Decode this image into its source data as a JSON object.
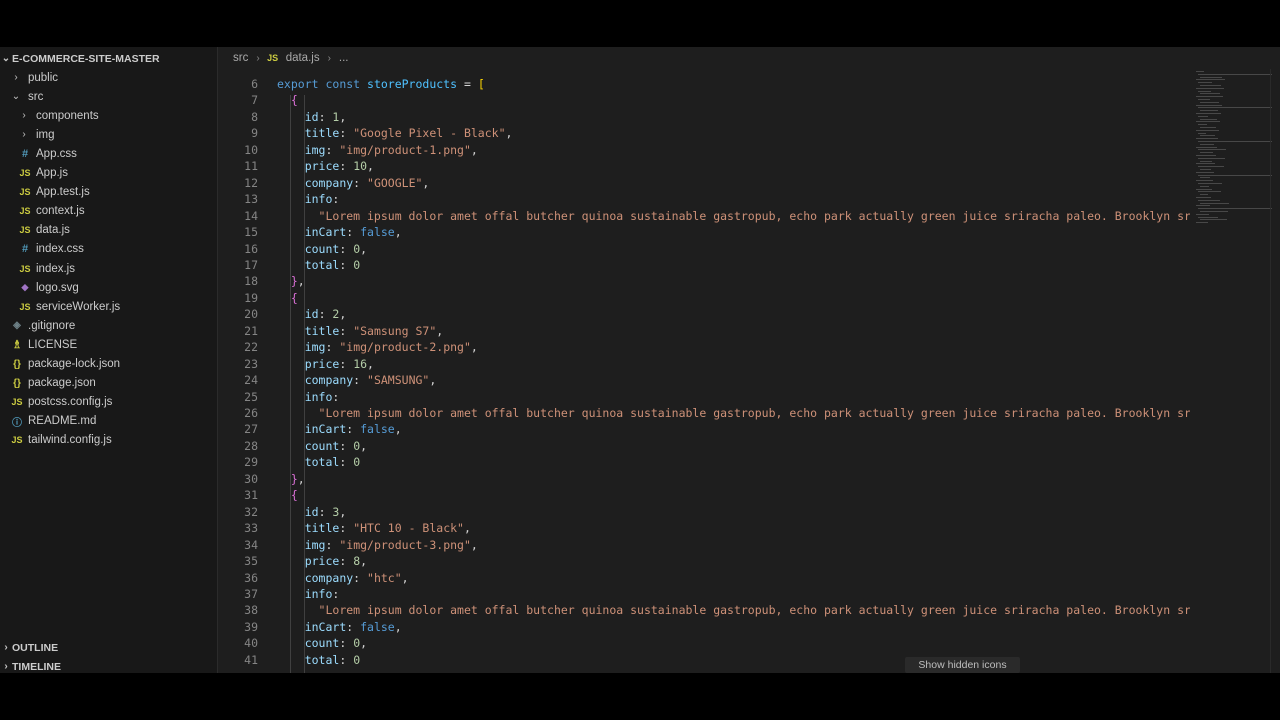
{
  "explorer": {
    "root": "E-COMMERCE-SITE-MASTER",
    "items": [
      {
        "label": "public",
        "kind": "folder",
        "chev": "›",
        "indent": 1
      },
      {
        "label": "src",
        "kind": "folder-open",
        "chev": "⌄",
        "indent": 1
      },
      {
        "label": "components",
        "kind": "folder",
        "chev": "›",
        "indent": 2
      },
      {
        "label": "img",
        "kind": "folder",
        "chev": "›",
        "indent": 2
      },
      {
        "label": "App.css",
        "kind": "css",
        "icon": "#",
        "indent": 2
      },
      {
        "label": "App.js",
        "kind": "js",
        "icon": "JS",
        "indent": 2
      },
      {
        "label": "App.test.js",
        "kind": "js",
        "icon": "JS",
        "indent": 2
      },
      {
        "label": "context.js",
        "kind": "js",
        "icon": "JS",
        "indent": 2
      },
      {
        "label": "data.js",
        "kind": "js",
        "icon": "JS",
        "indent": 2
      },
      {
        "label": "index.css",
        "kind": "css",
        "icon": "#",
        "indent": 2
      },
      {
        "label": "index.js",
        "kind": "js",
        "icon": "JS",
        "indent": 2
      },
      {
        "label": "logo.svg",
        "kind": "svg",
        "icon": "◆",
        "indent": 2
      },
      {
        "label": "serviceWorker.js",
        "kind": "js",
        "icon": "JS",
        "indent": 2
      },
      {
        "label": ".gitignore",
        "kind": "git",
        "icon": "◈",
        "indent": 1
      },
      {
        "label": "LICENSE",
        "kind": "lic",
        "icon": "♗",
        "indent": 1
      },
      {
        "label": "package-lock.json",
        "kind": "json",
        "icon": "{}",
        "indent": 1
      },
      {
        "label": "package.json",
        "kind": "json",
        "icon": "{}",
        "indent": 1
      },
      {
        "label": "postcss.config.js",
        "kind": "js",
        "icon": "JS",
        "indent": 1
      },
      {
        "label": "README.md",
        "kind": "md",
        "icon": "ⓘ",
        "indent": 1
      },
      {
        "label": "tailwind.config.js",
        "kind": "js",
        "icon": "JS",
        "indent": 1
      }
    ],
    "outline_label": "OUTLINE",
    "timeline_label": "TIMELINE"
  },
  "breadcrumb": {
    "folder": "src",
    "file_icon": "JS",
    "file": "data.js",
    "rest": "..."
  },
  "editor": {
    "lines": [
      {
        "n": "6",
        "tokens": [
          [
            "kw",
            "export "
          ],
          [
            "kw",
            "const "
          ],
          [
            "var",
            "storeProducts"
          ],
          [
            "pun",
            " = "
          ],
          [
            "b1",
            "["
          ]
        ]
      },
      {
        "n": "7",
        "tokens": [
          [
            "pun",
            "  "
          ],
          [
            "b2",
            "{"
          ]
        ]
      },
      {
        "n": "8",
        "tokens": [
          [
            "pun",
            "    "
          ],
          [
            "prop",
            "id"
          ],
          [
            "pun",
            ": "
          ],
          [
            "num",
            "1"
          ],
          [
            "pun",
            ","
          ]
        ]
      },
      {
        "n": "9",
        "tokens": [
          [
            "pun",
            "    "
          ],
          [
            "prop",
            "title"
          ],
          [
            "pun",
            ": "
          ],
          [
            "str",
            "\"Google Pixel - Black\""
          ],
          [
            "pun",
            ","
          ]
        ]
      },
      {
        "n": "10",
        "tokens": [
          [
            "pun",
            "    "
          ],
          [
            "prop",
            "img"
          ],
          [
            "pun",
            ": "
          ],
          [
            "str",
            "\"img/product-1.png\""
          ],
          [
            "pun",
            ","
          ]
        ]
      },
      {
        "n": "11",
        "tokens": [
          [
            "pun",
            "    "
          ],
          [
            "prop",
            "price"
          ],
          [
            "pun",
            ": "
          ],
          [
            "num",
            "10"
          ],
          [
            "pun",
            ","
          ]
        ]
      },
      {
        "n": "12",
        "tokens": [
          [
            "pun",
            "    "
          ],
          [
            "prop",
            "company"
          ],
          [
            "pun",
            ": "
          ],
          [
            "str",
            "\"GOOGLE\""
          ],
          [
            "pun",
            ","
          ]
        ]
      },
      {
        "n": "13",
        "tokens": [
          [
            "pun",
            "    "
          ],
          [
            "prop",
            "info"
          ],
          [
            "pun",
            ":"
          ]
        ]
      },
      {
        "n": "14",
        "tokens": [
          [
            "pun",
            "      "
          ],
          [
            "str",
            "\"Lorem ipsum dolor amet offal butcher quinoa sustainable gastropub, echo park actually green juice sriracha paleo. Brooklyn sriracha"
          ]
        ]
      },
      {
        "n": "15",
        "tokens": [
          [
            "pun",
            "    "
          ],
          [
            "prop",
            "inCart"
          ],
          [
            "pun",
            ": "
          ],
          [
            "kw",
            "false"
          ],
          [
            "pun",
            ","
          ]
        ]
      },
      {
        "n": "16",
        "tokens": [
          [
            "pun",
            "    "
          ],
          [
            "prop",
            "count"
          ],
          [
            "pun",
            ": "
          ],
          [
            "num",
            "0"
          ],
          [
            "pun",
            ","
          ]
        ]
      },
      {
        "n": "17",
        "tokens": [
          [
            "pun",
            "    "
          ],
          [
            "prop",
            "total"
          ],
          [
            "pun",
            ": "
          ],
          [
            "num",
            "0"
          ]
        ]
      },
      {
        "n": "18",
        "tokens": [
          [
            "pun",
            "  "
          ],
          [
            "b2",
            "}"
          ],
          [
            "pun",
            ","
          ]
        ]
      },
      {
        "n": "19",
        "tokens": [
          [
            "pun",
            "  "
          ],
          [
            "b2",
            "{"
          ]
        ]
      },
      {
        "n": "20",
        "tokens": [
          [
            "pun",
            "    "
          ],
          [
            "prop",
            "id"
          ],
          [
            "pun",
            ": "
          ],
          [
            "num",
            "2"
          ],
          [
            "pun",
            ","
          ]
        ]
      },
      {
        "n": "21",
        "tokens": [
          [
            "pun",
            "    "
          ],
          [
            "prop",
            "title"
          ],
          [
            "pun",
            ": "
          ],
          [
            "str",
            "\"Samsung S7\""
          ],
          [
            "pun",
            ","
          ]
        ]
      },
      {
        "n": "22",
        "tokens": [
          [
            "pun",
            "    "
          ],
          [
            "prop",
            "img"
          ],
          [
            "pun",
            ": "
          ],
          [
            "str",
            "\"img/product-2.png\""
          ],
          [
            "pun",
            ","
          ]
        ]
      },
      {
        "n": "23",
        "tokens": [
          [
            "pun",
            "    "
          ],
          [
            "prop",
            "price"
          ],
          [
            "pun",
            ": "
          ],
          [
            "num",
            "16"
          ],
          [
            "pun",
            ","
          ]
        ]
      },
      {
        "n": "24",
        "tokens": [
          [
            "pun",
            "    "
          ],
          [
            "prop",
            "company"
          ],
          [
            "pun",
            ": "
          ],
          [
            "str",
            "\"SAMSUNG\""
          ],
          [
            "pun",
            ","
          ]
        ]
      },
      {
        "n": "25",
        "tokens": [
          [
            "pun",
            "    "
          ],
          [
            "prop",
            "info"
          ],
          [
            "pun",
            ":"
          ]
        ]
      },
      {
        "n": "26",
        "tokens": [
          [
            "pun",
            "      "
          ],
          [
            "str",
            "\"Lorem ipsum dolor amet offal butcher quinoa sustainable gastropub, echo park actually green juice sriracha paleo. Brooklyn sriracha"
          ]
        ]
      },
      {
        "n": "27",
        "tokens": [
          [
            "pun",
            "    "
          ],
          [
            "prop",
            "inCart"
          ],
          [
            "pun",
            ": "
          ],
          [
            "kw",
            "false"
          ],
          [
            "pun",
            ","
          ]
        ]
      },
      {
        "n": "28",
        "tokens": [
          [
            "pun",
            "    "
          ],
          [
            "prop",
            "count"
          ],
          [
            "pun",
            ": "
          ],
          [
            "num",
            "0"
          ],
          [
            "pun",
            ","
          ]
        ]
      },
      {
        "n": "29",
        "tokens": [
          [
            "pun",
            "    "
          ],
          [
            "prop",
            "total"
          ],
          [
            "pun",
            ": "
          ],
          [
            "num",
            "0"
          ]
        ]
      },
      {
        "n": "30",
        "tokens": [
          [
            "pun",
            "  "
          ],
          [
            "b2",
            "}"
          ],
          [
            "pun",
            ","
          ]
        ]
      },
      {
        "n": "31",
        "tokens": [
          [
            "pun",
            "  "
          ],
          [
            "b2",
            "{"
          ]
        ]
      },
      {
        "n": "32",
        "tokens": [
          [
            "pun",
            "    "
          ],
          [
            "prop",
            "id"
          ],
          [
            "pun",
            ": "
          ],
          [
            "num",
            "3"
          ],
          [
            "pun",
            ","
          ]
        ]
      },
      {
        "n": "33",
        "tokens": [
          [
            "pun",
            "    "
          ],
          [
            "prop",
            "title"
          ],
          [
            "pun",
            ": "
          ],
          [
            "str",
            "\"HTC 10 - Black\""
          ],
          [
            "pun",
            ","
          ]
        ]
      },
      {
        "n": "34",
        "tokens": [
          [
            "pun",
            "    "
          ],
          [
            "prop",
            "img"
          ],
          [
            "pun",
            ": "
          ],
          [
            "str",
            "\"img/product-3.png\""
          ],
          [
            "pun",
            ","
          ]
        ]
      },
      {
        "n": "35",
        "tokens": [
          [
            "pun",
            "    "
          ],
          [
            "prop",
            "price"
          ],
          [
            "pun",
            ": "
          ],
          [
            "num",
            "8"
          ],
          [
            "pun",
            ","
          ]
        ]
      },
      {
        "n": "36",
        "tokens": [
          [
            "pun",
            "    "
          ],
          [
            "prop",
            "company"
          ],
          [
            "pun",
            ": "
          ],
          [
            "str",
            "\"htc\""
          ],
          [
            "pun",
            ","
          ]
        ]
      },
      {
        "n": "37",
        "tokens": [
          [
            "pun",
            "    "
          ],
          [
            "prop",
            "info"
          ],
          [
            "pun",
            ":"
          ]
        ]
      },
      {
        "n": "38",
        "tokens": [
          [
            "pun",
            "      "
          ],
          [
            "str",
            "\"Lorem ipsum dolor amet offal butcher quinoa sustainable gastropub, echo park actually green juice sriracha paleo. Brooklyn sriracha"
          ]
        ]
      },
      {
        "n": "39",
        "tokens": [
          [
            "pun",
            "    "
          ],
          [
            "prop",
            "inCart"
          ],
          [
            "pun",
            ": "
          ],
          [
            "kw",
            "false"
          ],
          [
            "pun",
            ","
          ]
        ]
      },
      {
        "n": "40",
        "tokens": [
          [
            "pun",
            "    "
          ],
          [
            "prop",
            "count"
          ],
          [
            "pun",
            ": "
          ],
          [
            "num",
            "0"
          ],
          [
            "pun",
            ","
          ]
        ]
      },
      {
        "n": "41",
        "tokens": [
          [
            "pun",
            "    "
          ],
          [
            "prop",
            "total"
          ],
          [
            "pun",
            ": "
          ],
          [
            "num",
            "0"
          ]
        ]
      }
    ]
  },
  "hint": "Show hidden icons",
  "colors": {
    "editor_bg": "#1e1e1e",
    "sidebar_bg": "#181818",
    "keyword": "#569cd6",
    "string": "#ce9178",
    "property": "#9cdcfe",
    "number": "#b5cea8"
  }
}
